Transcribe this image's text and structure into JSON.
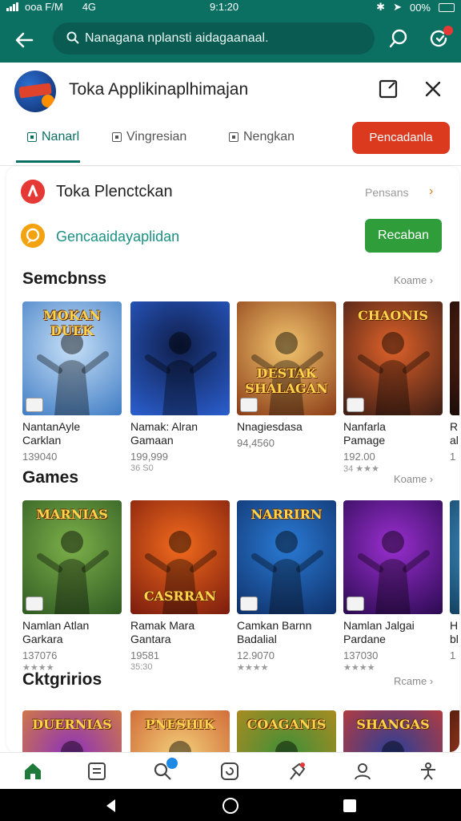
{
  "status": {
    "carrier": "ooa F/M",
    "network": "4G",
    "time": "9:1:20",
    "battery": "00%"
  },
  "search": {
    "placeholder": "Nanagana nplansti aidagaanaal."
  },
  "app": {
    "title": "Toka Applikinaplhimajan",
    "tabs": [
      "Nanarl",
      "Vingresian",
      "Nengkan"
    ],
    "active_tab_index": 0,
    "cta_label": "Pencadanla"
  },
  "rows": {
    "first": {
      "title": "Toka Plenctckan",
      "aside": "Pensans",
      "chevron": "›"
    },
    "second": {
      "title": "Gencaaidayaplidan",
      "button": "Recaban"
    }
  },
  "sections": [
    {
      "title": "Semcbnss",
      "more": "Koame ›",
      "items": [
        {
          "overlay": "MOKAN DUEK",
          "name1": "NantanAyle",
          "name2": "Carklan",
          "price": "139040",
          "sub": ""
        },
        {
          "overlay": "",
          "name1": "Namak: Alran",
          "name2": "Gamaan",
          "price": "199,999",
          "sub": "36 S0"
        },
        {
          "overlay": "DESTAK SHALAGAN",
          "name1": "Nnagiesdasa",
          "name2": "",
          "price": "94,4560",
          "sub": ""
        },
        {
          "overlay": "CHAONIS",
          "name1": "Nanfarla",
          "name2": "Pamage",
          "price": "192.00",
          "sub": "34 ★★★"
        },
        {
          "overlay": "",
          "name1": "R",
          "name2": "al",
          "price": "1",
          "sub": ""
        }
      ]
    },
    {
      "title": "Games",
      "more": "Koame ›",
      "items": [
        {
          "overlay": "MARNIAS",
          "name1": "Namlan Atlan",
          "name2": "Garkara",
          "price": "137076",
          "sub": "★★★★"
        },
        {
          "overlay": "CASRRAN",
          "name1": "Ramak Mara",
          "name2": "Gantara",
          "price": "19581",
          "sub": "35:30"
        },
        {
          "overlay": "NARRIRN",
          "name1": "Camkan Barnn",
          "name2": "Badalial",
          "price": "12.9070",
          "sub": "★★★★"
        },
        {
          "overlay": "",
          "name1": "Namlan Jalgai",
          "name2": "Pardane",
          "price": "137030",
          "sub": "★★★★"
        },
        {
          "overlay": "",
          "name1": "H",
          "name2": "bl",
          "price": "1",
          "sub": ""
        }
      ]
    },
    {
      "title": "Cktgririos",
      "more": "Rcame ›",
      "items": [
        {
          "overlay": "DUERNIAS",
          "name1": "",
          "name2": "",
          "price": "",
          "sub": ""
        },
        {
          "overlay": "PNESHIK",
          "name1": "",
          "name2": "",
          "price": "",
          "sub": ""
        },
        {
          "overlay": "COAGANIS",
          "name1": "",
          "name2": "",
          "price": "",
          "sub": ""
        },
        {
          "overlay": "SHANGAS",
          "name1": "",
          "name2": "",
          "price": "",
          "sub": ""
        },
        {
          "overlay": "",
          "name1": "",
          "name2": "",
          "price": "",
          "sub": ""
        }
      ]
    }
  ],
  "colors": {
    "brand": "#0b6f62",
    "cta": "#db3a1f",
    "accent_green": "#2f9e3a",
    "link_teal": "#1b9183"
  },
  "bottom_nav": [
    "home-icon",
    "list-icon",
    "search-icon",
    "refresh-icon",
    "pin-icon",
    "profile-icon",
    "accessibility-icon"
  ],
  "bottom_nav_active": 0
}
